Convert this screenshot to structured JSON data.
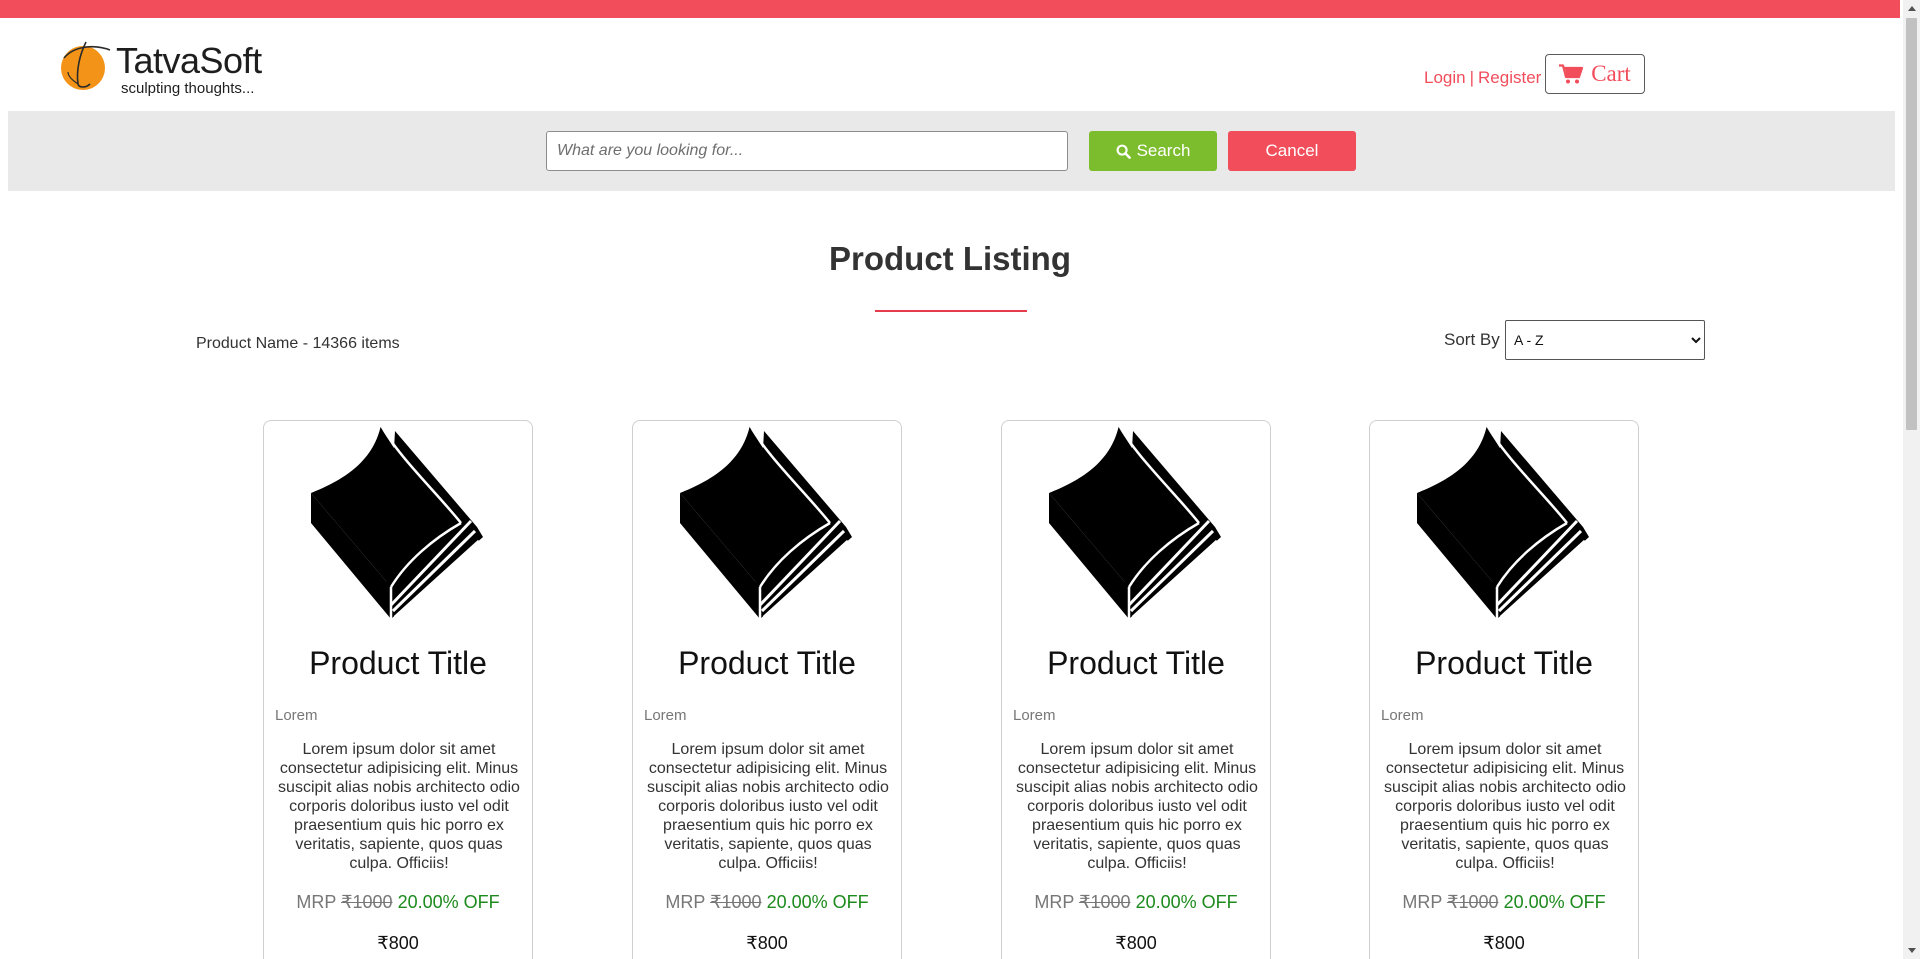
{
  "brand": {
    "name": "TatvaSoft",
    "tagline": "sculpting thoughts...",
    "accent_color": "#f14d5b"
  },
  "header": {
    "login_label": "Login",
    "separator": "|",
    "register_label": "Register",
    "cart_label": "Cart",
    "cart_icon": "shopping-cart-icon"
  },
  "search": {
    "placeholder": "What are you looking for...",
    "value": "",
    "search_label": "Search",
    "search_icon": "search-icon",
    "cancel_label": "Cancel",
    "search_color": "#7cbd2e"
  },
  "listing": {
    "title": "Product Listing",
    "count_text": "Product Name - 14366 items",
    "sort_label": "Sort By :",
    "sort_selected": "A - Z"
  },
  "products": [
    {
      "image_icon": "book-icon",
      "title": "Product Title",
      "category": "Lorem",
      "description": "Lorem ipsum dolor sit amet consectetur adipisicing elit. Minus suscipit alias nobis architecto odio corporis doloribus iusto vel odit praesentium quis hic porro ex veritatis, sapiente, quos quas culpa. Officiis!",
      "mrp_label": "MRP",
      "mrp_value": "₹1000",
      "discount": "20.00% OFF",
      "price": "₹800"
    },
    {
      "image_icon": "book-icon",
      "title": "Product Title",
      "category": "Lorem",
      "description": "Lorem ipsum dolor sit amet consectetur adipisicing elit. Minus suscipit alias nobis architecto odio corporis doloribus iusto vel odit praesentium quis hic porro ex veritatis, sapiente, quos quas culpa. Officiis!",
      "mrp_label": "MRP",
      "mrp_value": "₹1000",
      "discount": "20.00% OFF",
      "price": "₹800"
    },
    {
      "image_icon": "book-icon",
      "title": "Product Title",
      "category": "Lorem",
      "description": "Lorem ipsum dolor sit amet consectetur adipisicing elit. Minus suscipit alias nobis architecto odio corporis doloribus iusto vel odit praesentium quis hic porro ex veritatis, sapiente, quos quas culpa. Officiis!",
      "mrp_label": "MRP",
      "mrp_value": "₹1000",
      "discount": "20.00% OFF",
      "price": "₹800"
    },
    {
      "image_icon": "book-icon",
      "title": "Product Title",
      "category": "Lorem",
      "description": "Lorem ipsum dolor sit amet consectetur adipisicing elit. Minus suscipit alias nobis architecto odio corporis doloribus iusto vel odit praesentium quis hic porro ex veritatis, sapiente, quos quas culpa. Officiis!",
      "mrp_label": "MRP",
      "mrp_value": "₹1000",
      "discount": "20.00% OFF",
      "price": "₹800"
    }
  ]
}
